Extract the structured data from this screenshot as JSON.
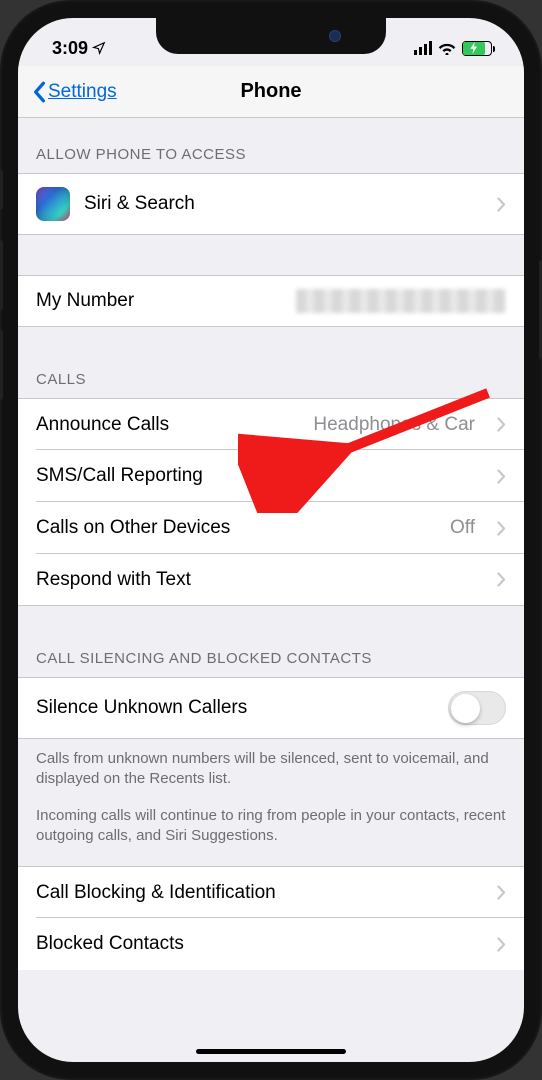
{
  "status": {
    "time": "3:09"
  },
  "header": {
    "back_label": "Settings",
    "title": "Phone"
  },
  "sections": {
    "access": {
      "header": "ALLOW PHONE TO ACCESS",
      "siri_label": "Siri & Search"
    },
    "my_number": {
      "label": "My Number"
    },
    "calls": {
      "header": "CALLS",
      "announce_label": "Announce Calls",
      "announce_value": "Headphones & Car",
      "sms_label": "SMS/Call Reporting",
      "other_devices_label": "Calls on Other Devices",
      "other_devices_value": "Off",
      "respond_label": "Respond with Text"
    },
    "silencing": {
      "header": "CALL SILENCING AND BLOCKED CONTACTS",
      "silence_label": "Silence Unknown Callers",
      "silence_on": false,
      "footer1": "Calls from unknown numbers will be silenced, sent to voicemail, and displayed on the Recents list.",
      "footer2": "Incoming calls will continue to ring from people in your contacts, recent outgoing calls, and Siri Suggestions.",
      "blocking_label": "Call Blocking & Identification",
      "blocked_contacts_label": "Blocked Contacts"
    }
  }
}
